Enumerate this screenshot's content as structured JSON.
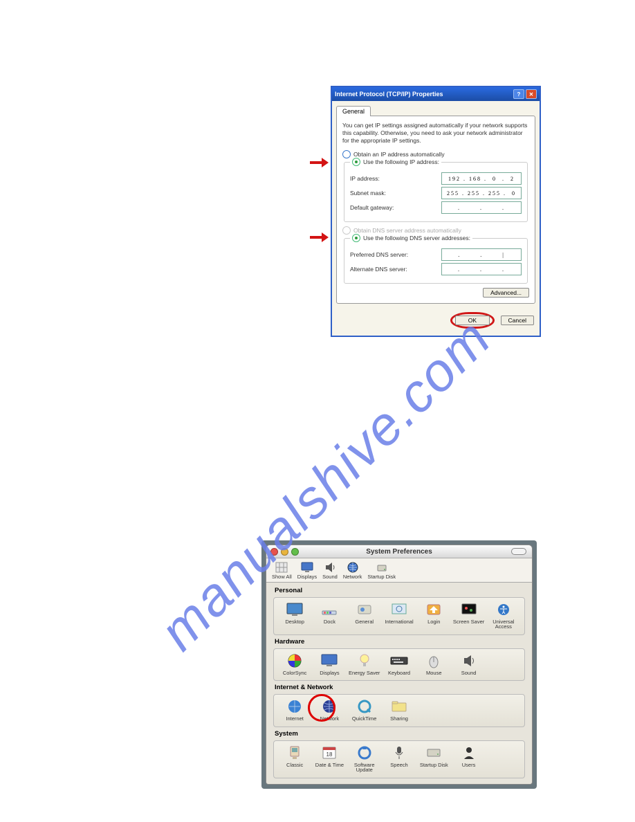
{
  "watermark": "manualshive.com",
  "xp": {
    "title": "Internet Protocol (TCP/IP) Properties",
    "tab": "General",
    "description": "You can get IP settings assigned automatically if your network supports this capability. Otherwise, you need to ask your network administrator for the appropriate IP settings.",
    "radio_obtain_ip": "Obtain an IP address automatically",
    "radio_use_ip": "Use the following IP address:",
    "ip_label": "IP address:",
    "ip_value": "192 . 168 .  0  .  2",
    "subnet_label": "Subnet mask:",
    "subnet_value": "255 . 255 . 255 .  0",
    "gateway_label": "Default gateway:",
    "gateway_value": ".       .       .",
    "radio_obtain_dns": "Obtain DNS server address automatically",
    "radio_use_dns": "Use the following DNS server addresses:",
    "pref_dns_label": "Preferred DNS server:",
    "pref_dns_value": ".       .       |",
    "alt_dns_label": "Alternate DNS server:",
    "alt_dns_value": ".       .       .",
    "advanced": "Advanced...",
    "ok": "OK",
    "cancel": "Cancel"
  },
  "mac": {
    "title": "System Preferences",
    "toolbar": [
      "Show All",
      "Displays",
      "Sound",
      "Network",
      "Startup Disk"
    ],
    "sections": {
      "personal": {
        "title": "Personal",
        "items": [
          "Desktop",
          "Dock",
          "General",
          "International",
          "Login",
          "Screen Saver",
          "Universal Access"
        ]
      },
      "hardware": {
        "title": "Hardware",
        "items": [
          "ColorSync",
          "Displays",
          "Energy Saver",
          "Keyboard",
          "Mouse",
          "Sound"
        ]
      },
      "internet": {
        "title": "Internet & Network",
        "items": [
          "Internet",
          "Network",
          "QuickTime",
          "Sharing"
        ]
      },
      "system": {
        "title": "System",
        "items": [
          "Classic",
          "Date & Time",
          "Software Update",
          "Speech",
          "Startup Disk",
          "Users"
        ]
      }
    }
  }
}
